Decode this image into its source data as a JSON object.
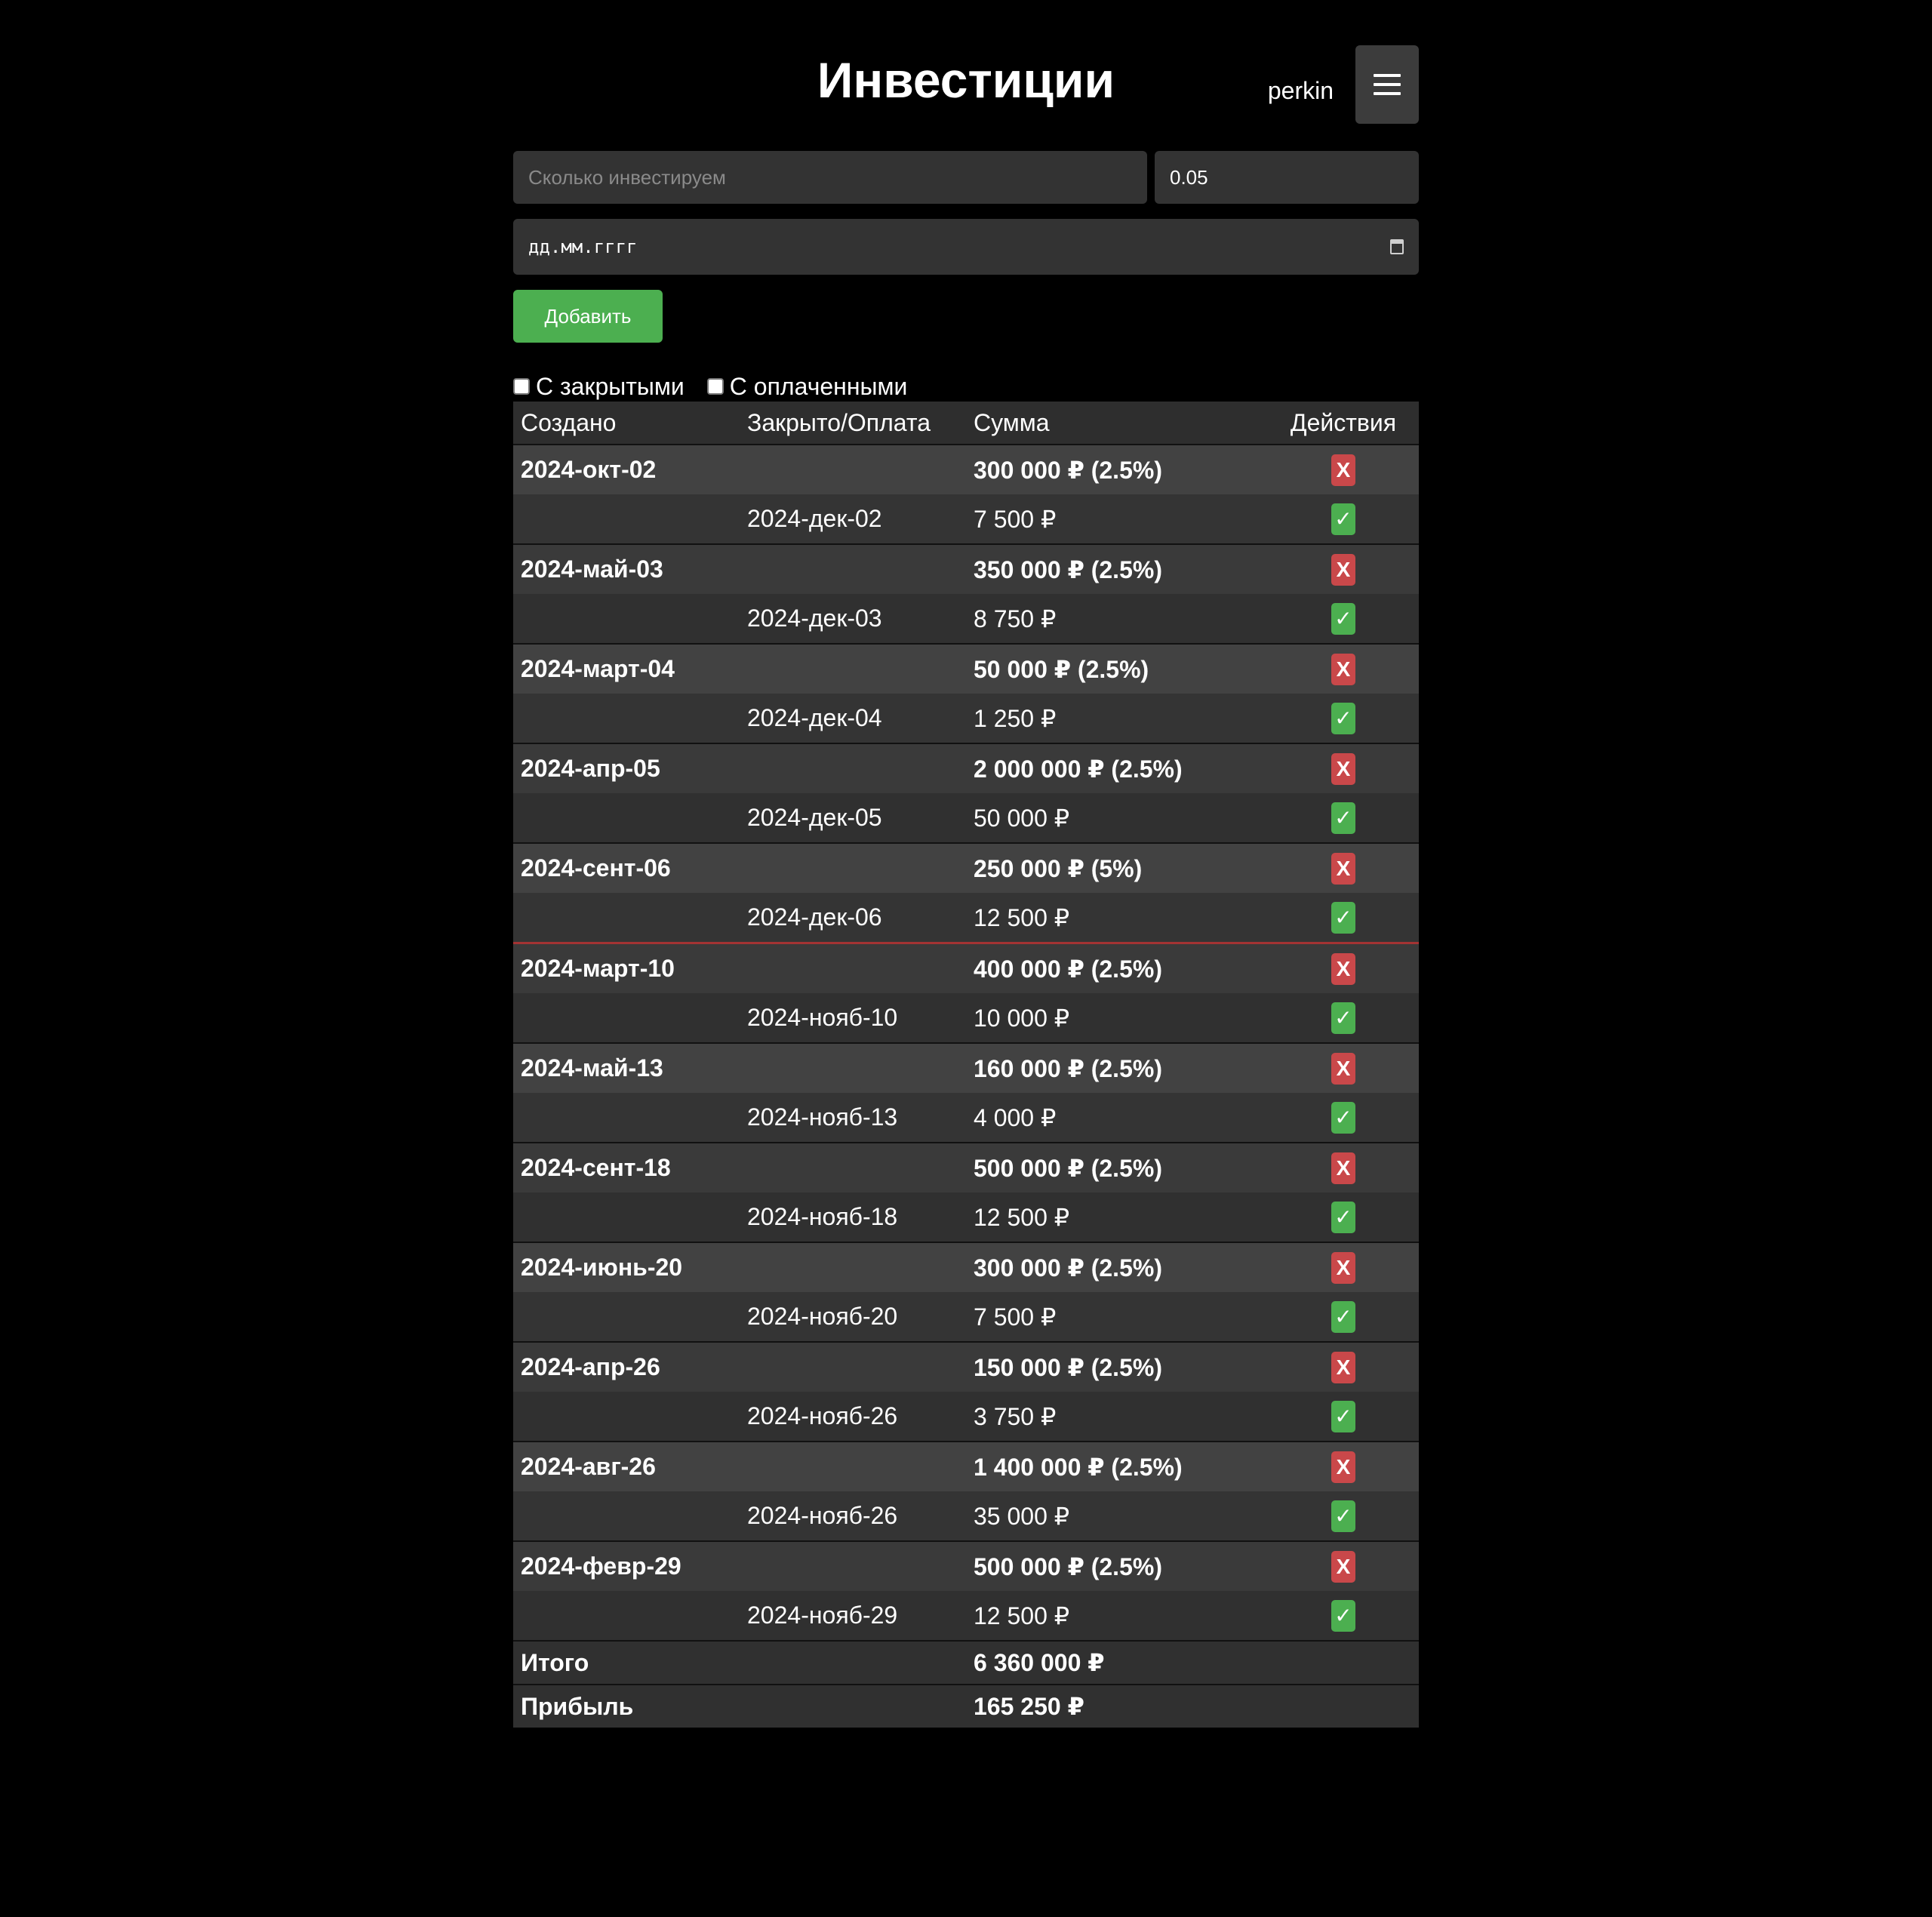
{
  "header": {
    "title": "Инвестиции",
    "user": "perkin"
  },
  "form": {
    "amount_placeholder": "Сколько инвестируем",
    "rate_value": "0.05",
    "date_placeholder": "дд.мм.гггг",
    "add_label": "Добавить"
  },
  "filters": {
    "closed_label": "С закрытыми",
    "paid_label": "С оплаченными"
  },
  "table": {
    "headers": {
      "created": "Создано",
      "closed": "Закрыто/Оплата",
      "amount": "Сумма",
      "actions": "Действия"
    },
    "groups": [
      {
        "created": "2024-окт-02",
        "amount": "300 000 ₽ (2.5%)",
        "pay_date": "2024-дек-02",
        "pay_amount": "7 500 ₽"
      },
      {
        "created": "2024-май-03",
        "amount": "350 000 ₽ (2.5%)",
        "pay_date": "2024-дек-03",
        "pay_amount": "8 750 ₽"
      },
      {
        "created": "2024-март-04",
        "amount": "50 000 ₽ (2.5%)",
        "pay_date": "2024-дек-04",
        "pay_amount": "1 250 ₽"
      },
      {
        "created": "2024-апр-05",
        "amount": "2 000 000 ₽ (2.5%)",
        "pay_date": "2024-дек-05",
        "pay_amount": "50 000 ₽"
      },
      {
        "created": "2024-сент-06",
        "amount": "250 000 ₽ (5%)",
        "pay_date": "2024-дек-06",
        "pay_amount": "12 500 ₽"
      },
      {
        "created": "2024-март-10",
        "amount": "400 000 ₽ (2.5%)",
        "pay_date": "2024-нояб-10",
        "pay_amount": "10 000 ₽"
      },
      {
        "created": "2024-май-13",
        "amount": "160 000 ₽ (2.5%)",
        "pay_date": "2024-нояб-13",
        "pay_amount": "4 000 ₽"
      },
      {
        "created": "2024-сент-18",
        "amount": "500 000 ₽ (2.5%)",
        "pay_date": "2024-нояб-18",
        "pay_amount": "12 500 ₽"
      },
      {
        "created": "2024-июнь-20",
        "amount": "300 000 ₽ (2.5%)",
        "pay_date": "2024-нояб-20",
        "pay_amount": "7 500 ₽"
      },
      {
        "created": "2024-апр-26",
        "amount": "150 000 ₽ (2.5%)",
        "pay_date": "2024-нояб-26",
        "pay_amount": "3 750 ₽"
      },
      {
        "created": "2024-авг-26",
        "amount": "1 400 000 ₽ (2.5%)",
        "pay_date": "2024-нояб-26",
        "pay_amount": "35 000 ₽"
      },
      {
        "created": "2024-февр-29",
        "amount": "500 000 ₽ (2.5%)",
        "pay_date": "2024-нояб-29",
        "pay_amount": "12 500 ₽"
      }
    ],
    "delete_symbol": "X",
    "confirm_symbol": "✓",
    "total_label": "Итого",
    "total_value": "6 360 000 ₽",
    "profit_label": "Прибыль",
    "profit_value": "165 250 ₽"
  },
  "colors": {
    "background": "#000000",
    "panel": "#333333",
    "accent_green": "#4caf50",
    "delete_red": "#c9484a"
  }
}
